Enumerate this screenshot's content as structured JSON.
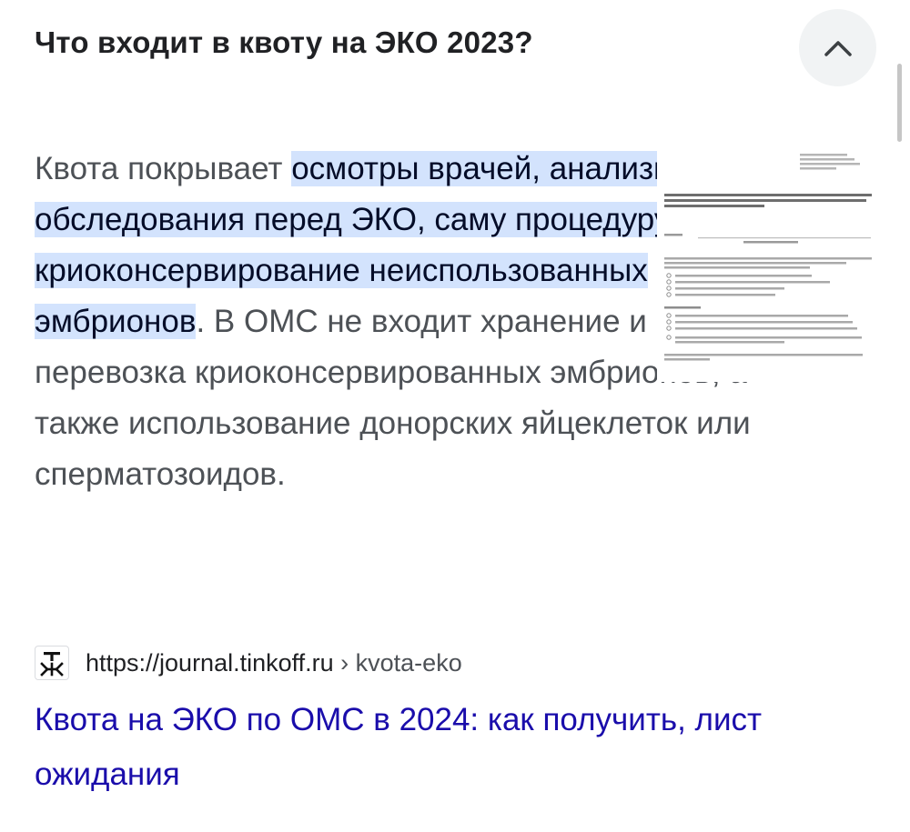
{
  "question": {
    "title": "Что входит в квоту на ЭКО 2023?",
    "toggle_icon": "chevron-up-icon",
    "expanded": true
  },
  "answer": {
    "text_before": "Квота покрывает ",
    "highlight": "осмотры врачей, анализы и обследования перед ЭКО, саму процедуру и криоконсервирование неиспользованных эмбрионов",
    "text_after": ". В ОМС не входит хранение и перевозка криоконсервированных эмбрионов, а также использование донорских яйцеклеток или сперматозоидов.",
    "thumbnail_icon": "document-thumbnail"
  },
  "source": {
    "favicon_icon": "tinkoff-journal-favicon",
    "url": "https://journal.tinkoff.ru",
    "path": " › kvota-eko"
  },
  "result": {
    "title": "Квота на ЭКО по ОМС в 2024: как получить, лист ожидания"
  },
  "colors": {
    "highlight_bg": "#d3e3fd",
    "link": "#1a0dab",
    "body_text": "#4d5156",
    "title_text": "#202124"
  }
}
